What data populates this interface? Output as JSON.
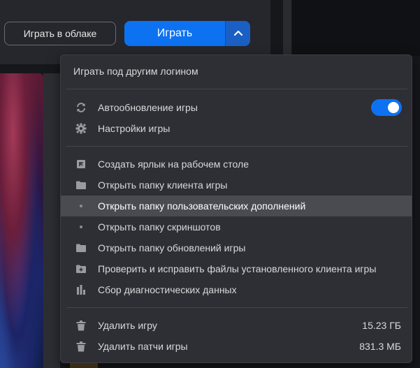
{
  "header": {
    "cloud_play_label": "Играть в облаке",
    "play_label": "Играть"
  },
  "menu": {
    "login_item": "Играть под другим логином",
    "auto_update": {
      "label": "Автообновление игры",
      "enabled": true
    },
    "settings": "Настройки игры",
    "actions": [
      {
        "label": "Создать ярлык на рабочем столе",
        "icon": "shortcut-icon"
      },
      {
        "label": "Открыть папку клиента игры",
        "icon": "folder-icon"
      },
      {
        "label": "Открыть папку пользовательских дополнений",
        "icon": "dot-icon"
      },
      {
        "label": "Открыть папку скриншотов",
        "icon": "dot-icon"
      },
      {
        "label": "Открыть папку обновлений игры",
        "icon": "folder-icon"
      },
      {
        "label": "Проверить и исправить файлы установленного клиента игры",
        "icon": "folder-plus-icon"
      },
      {
        "label": "Сбор диагностических данных",
        "icon": "bar-chart-icon"
      }
    ],
    "uninstall": {
      "label": "Удалить игру",
      "size": "15.23 ГБ"
    },
    "uninstall_patches": {
      "label": "Удалить патчи игры",
      "size": "831.3 МБ"
    }
  },
  "colors": {
    "accent": "#0d72f2",
    "menu_bg": "#2e2f34",
    "highlight": "#4a4b51"
  }
}
